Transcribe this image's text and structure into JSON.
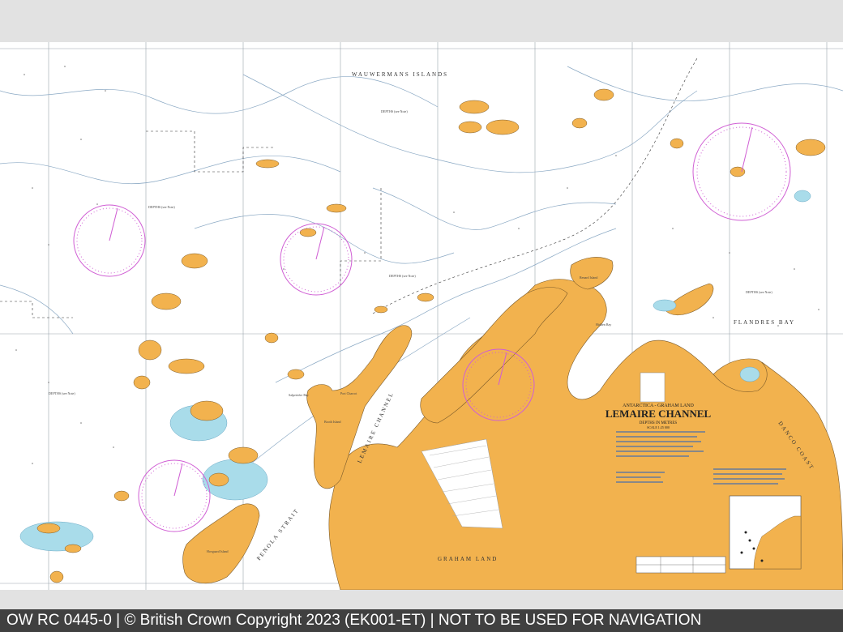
{
  "footer": {
    "text": "OW RC 0445-0 | © British Crown Copyright 2023 (EK001-ET) | NOT TO BE USED FOR NAVIGATION"
  },
  "chart": {
    "region": "ANTARCTICA - GRAHAM LAND",
    "title": "LEMAIRE CHANNEL",
    "depths": "DEPTHS IN METRES",
    "scale": "SCALE 1:25 000"
  },
  "places": {
    "wauwermans": "WAUWERMANS ISLANDS",
    "graham_land": "GRAHAM LAND",
    "flandres_bay": "FLANDRES BAY",
    "booth_island": "Booth Island",
    "port_charcot": "Port Charcot",
    "salpetriere_bay": "Salpetrière Bay",
    "hovgaard_island": "Hovgaard Island",
    "renard_island": "Renard Island",
    "penola_strait": "PENOLA STRAIT",
    "lemaire_channel_label": "LEMAIRE CHANNEL",
    "danco_coast": "DANCO COAST",
    "hidden_bay": "Hidden Bay"
  },
  "depth_note": "DEPTHS (see Note)",
  "colors": {
    "land": "#f2b24e",
    "shoal": "#a9dcea",
    "compass": "#d05fd4",
    "footer_bg": "#404040"
  }
}
